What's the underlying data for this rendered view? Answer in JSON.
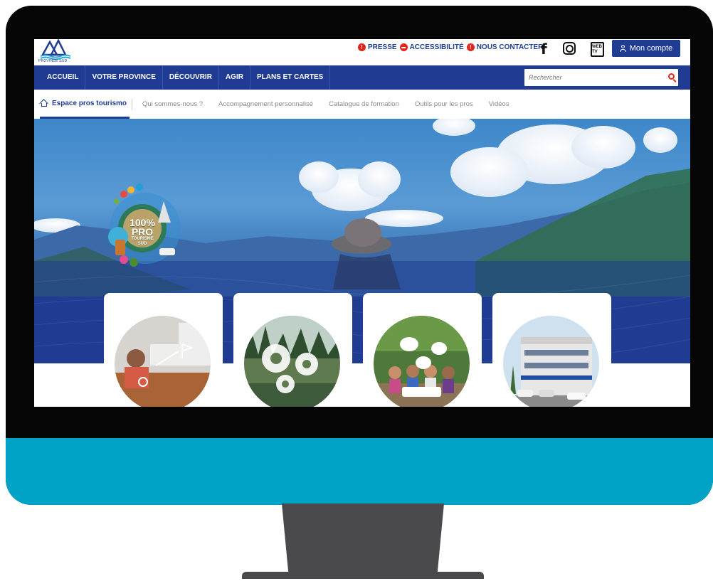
{
  "topbar": {
    "logo_caption": "PROVINCE SUD",
    "links": [
      {
        "label": "PRESSE",
        "marker": "!"
      },
      {
        "label": "ACCESSIBILITÉ",
        "marker": "–"
      },
      {
        "label": "NOUS CONTACTER",
        "marker": "!"
      }
    ],
    "social_icons": [
      "facebook-icon",
      "instagram-icon",
      "web-tv-icon"
    ],
    "web_tv_label": "WEB TV",
    "account_label": "Mon compte"
  },
  "nav": {
    "items": [
      "ACCUEIL",
      "VOTRE PROVINCE",
      "DÉCOUVRIR",
      "AGIR",
      "PLANS ET CARTES"
    ],
    "search_placeholder": "Rechercher"
  },
  "subnav": {
    "active": "Espace pros tourismo",
    "items": [
      "Qui sommes-nous ?",
      "Accompagnement personnalisé",
      "Catalogue de formation",
      "Outils pour les pros",
      "Vidéos"
    ]
  },
  "hero": {
    "badge_main": "100% PRO",
    "badge_sub": "TOURISME SUD"
  },
  "cards": [
    {
      "image": "office-meeting-photo"
    },
    {
      "image": "forest-gears-photo"
    },
    {
      "image": "group-discussion-photo"
    },
    {
      "image": "building-photo"
    }
  ],
  "colors": {
    "brand_blue": "#1f3c92",
    "alert_red": "#e4251b",
    "monitor_chin": "#00a2c6",
    "monitor_bezel": "#050505",
    "stand": "#4a4a4c"
  }
}
